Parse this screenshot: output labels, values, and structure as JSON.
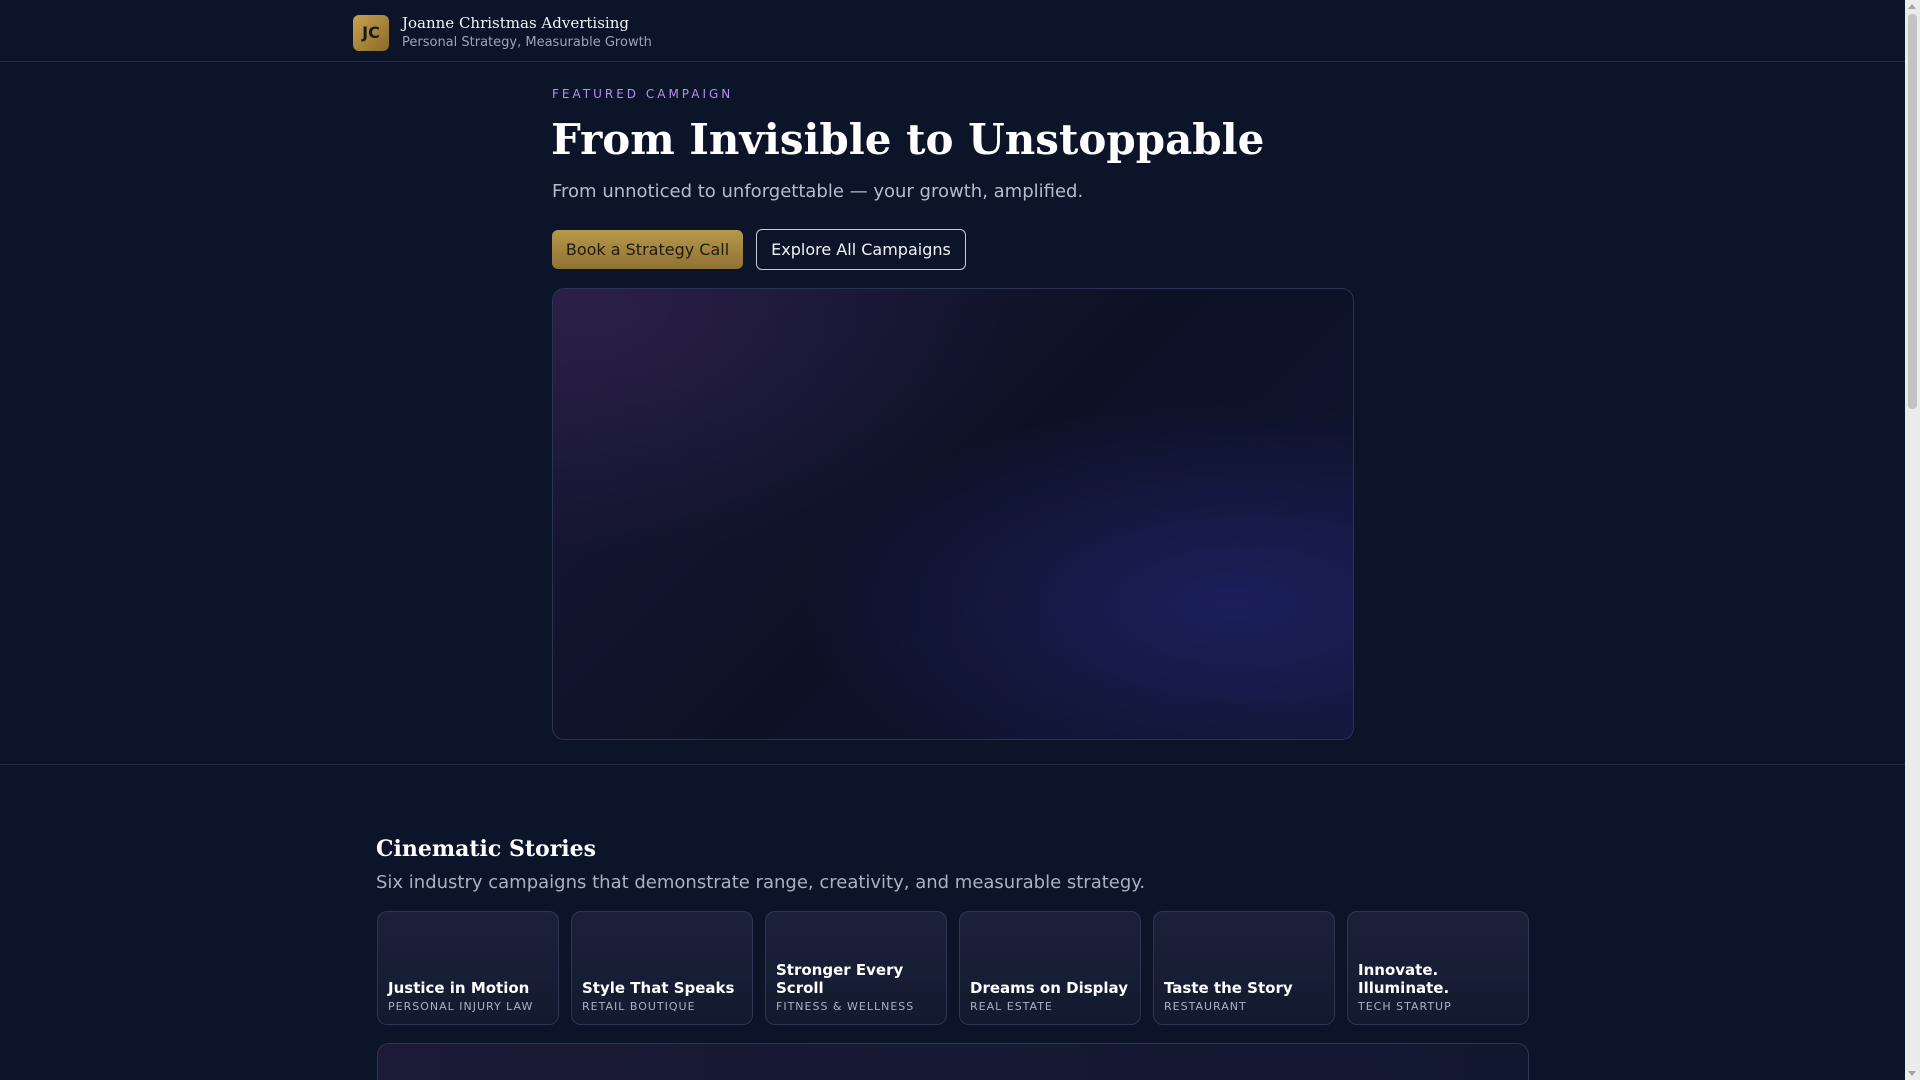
{
  "header": {
    "logo_initials": "JC",
    "brand_name": "Joanne Christmas Advertising",
    "tagline": "Personal Strategy, Measurable Growth"
  },
  "hero": {
    "eyebrow": "FEATURED CAMPAIGN",
    "title": "From Invisible to Unstoppable",
    "subtitle": "From unnoticed to unforgettable — your growth, amplified.",
    "primary_button": "Book a Strategy Call",
    "secondary_button": "Explore All Campaigns"
  },
  "stories": {
    "title": "Cinematic Stories",
    "subtitle": "Six industry campaigns that demonstrate range, creativity, and measurable strategy.",
    "cards": [
      {
        "title": "Justice in Motion",
        "category": "PERSONAL INJURY LAW"
      },
      {
        "title": "Style That Speaks",
        "category": "RETAIL BOUTIQUE"
      },
      {
        "title": "Stronger Every Scroll",
        "category": "FITNESS & WELLNESS"
      },
      {
        "title": "Dreams on Display",
        "category": "REAL ESTATE"
      },
      {
        "title": "Taste the Story",
        "category": "RESTAURANT"
      },
      {
        "title": "Innovate. Illuminate.",
        "category": "TECH STARTUP"
      }
    ]
  },
  "colors": {
    "background": "#0b1428",
    "accent_gold": "#b8984a",
    "eyebrow_purple": "#b78ff0"
  }
}
